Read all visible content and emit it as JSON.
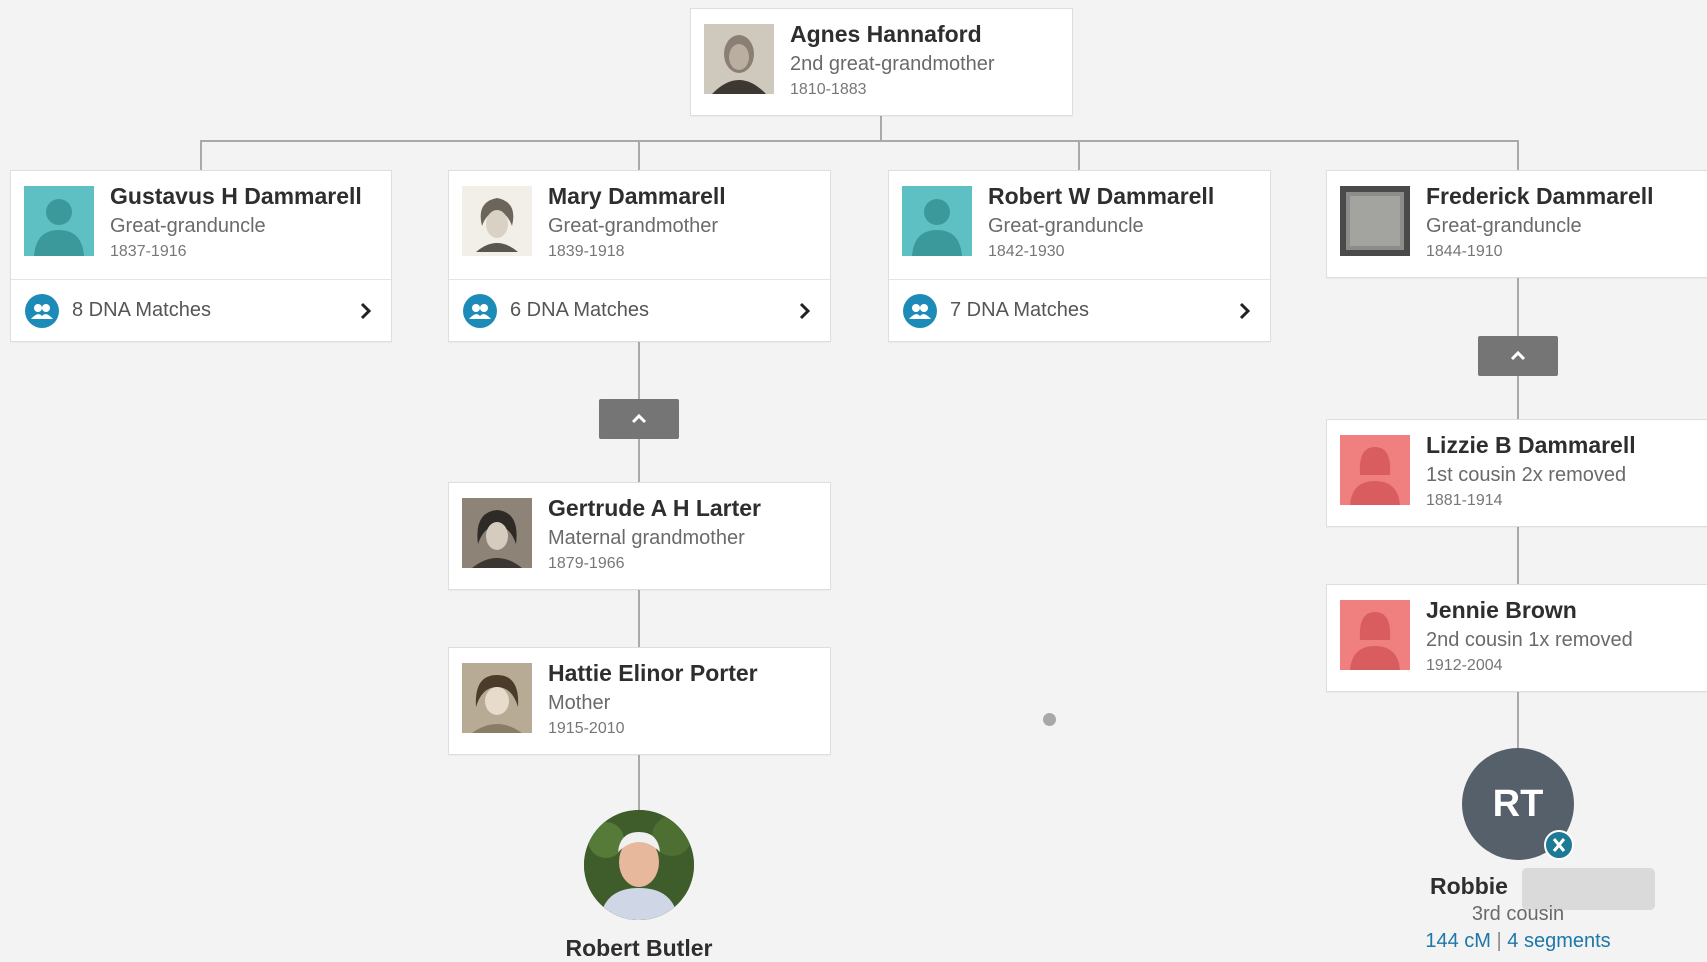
{
  "colors": {
    "accent": "#1d8bb8",
    "male_placeholder": "#5ec0c2",
    "female_placeholder": "#f07f80",
    "connector": "#a9a9a9",
    "link": "#1d77a8"
  },
  "root": {
    "name": "Agnes Hannaford",
    "relationship": "2nd great-grandmother",
    "dates": "1810-1883",
    "photo": "portrait-photo"
  },
  "children": [
    {
      "name": "Gustavus H Dammarell",
      "relationship": "Great-granduncle",
      "dates": "1837-1916",
      "photo": "male-silhouette",
      "dna_matches": "8 DNA Matches"
    },
    {
      "name": "Mary Dammarell",
      "relationship": "Great-grandmother",
      "dates": "1839-1918",
      "photo": "portrait-sketch",
      "dna_matches": "6 DNA Matches"
    },
    {
      "name": "Robert W Dammarell",
      "relationship": "Great-granduncle",
      "dates": "1842-1930",
      "photo": "male-silhouette",
      "dna_matches": "7 DNA Matches"
    },
    {
      "name": "Frederick Dammarell",
      "relationship": "Great-granduncle",
      "dates": "1844-1910",
      "photo": "document-photo"
    }
  ],
  "mary_line": [
    {
      "name": "Gertrude A H Larter",
      "relationship": "Maternal grandmother",
      "dates": "1879-1966",
      "photo": "portrait-photo"
    },
    {
      "name": "Hattie Elinor Porter",
      "relationship": "Mother",
      "dates": "1915-2010",
      "photo": "portrait-photo"
    }
  ],
  "self": {
    "name": "Robert Butler"
  },
  "frederick_line": [
    {
      "name": "Lizzie B Dammarell",
      "relationship": "1st cousin 2x removed",
      "dates": "1881-1914",
      "photo": "female-silhouette"
    },
    {
      "name": "Jennie Brown",
      "relationship": "2nd cousin 1x removed",
      "dates": "1912-2004",
      "photo": "female-silhouette"
    }
  ],
  "match": {
    "initials": "RT",
    "name": "Robbie",
    "relationship": "3rd cousin",
    "cm": "144 cM",
    "separator": "|",
    "segments": "4 segments"
  },
  "icons": {
    "dna": "dna-match-icon",
    "chevron_right": "chevron-right-icon",
    "collapse": "chevron-up-icon",
    "badge": "dna-x-badge-icon"
  }
}
